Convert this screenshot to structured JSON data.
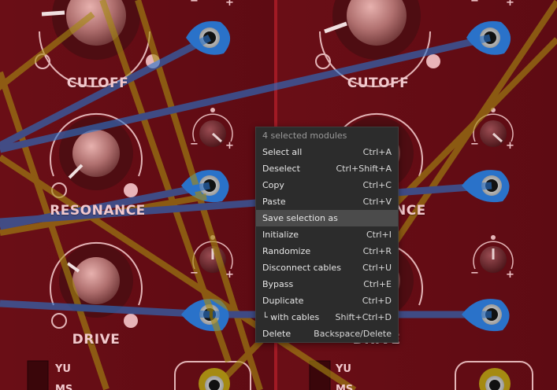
{
  "colors": {
    "panel": "#6e1018",
    "panel_dark": "#560a12",
    "label": "#f2c8cc",
    "cable_blue": "#2a72c9",
    "cable_yellow": "#a58a12",
    "menu_bg": "#2c2c2c",
    "menu_highlight": "#4b4b4b"
  },
  "modules": [
    {
      "cutoff_label": "CUTOFF",
      "resonance_label": "RESONANCE",
      "drive_label": "DRIVE",
      "switch_labels": [
        "YU",
        "MS"
      ],
      "minus": "−",
      "plus": "+"
    },
    {
      "cutoff_label": "CUTOFF",
      "resonance_label": "RESONANCE",
      "drive_label": "DRIVE",
      "switch_labels": [
        "YU",
        "MS"
      ],
      "minus": "−",
      "plus": "+"
    }
  ],
  "context_menu": {
    "header": "4 selected modules",
    "items": [
      {
        "label": "Select all",
        "shortcut": "Ctrl+A"
      },
      {
        "label": "Deselect",
        "shortcut": "Ctrl+Shift+A"
      },
      {
        "label": "Copy",
        "shortcut": "Ctrl+C"
      },
      {
        "label": "Paste",
        "shortcut": "Ctrl+V"
      },
      {
        "label": "Save selection as",
        "shortcut": ""
      },
      {
        "label": "Initialize",
        "shortcut": "Ctrl+I"
      },
      {
        "label": "Randomize",
        "shortcut": "Ctrl+R"
      },
      {
        "label": "Disconnect cables",
        "shortcut": "Ctrl+U"
      },
      {
        "label": "Bypass",
        "shortcut": "Ctrl+E"
      },
      {
        "label": "Duplicate",
        "shortcut": "Ctrl+D"
      },
      {
        "label": "└ with cables",
        "shortcut": "Shift+Ctrl+D"
      },
      {
        "label": "Delete",
        "shortcut": "Backspace/Delete"
      }
    ],
    "highlighted_item": "Save selection as"
  }
}
